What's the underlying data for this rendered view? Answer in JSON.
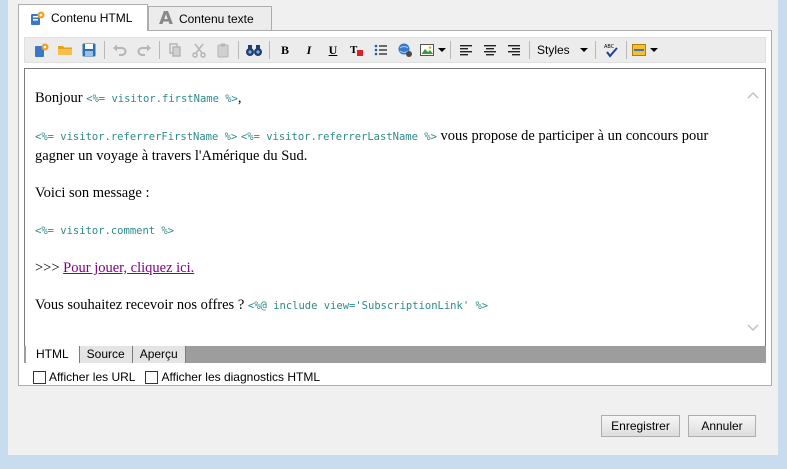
{
  "tabs": [
    {
      "label": "Contenu HTML",
      "icon": "html-doc-icon",
      "active": true
    },
    {
      "label": "Contenu texte",
      "icon": "text-A-icon",
      "active": false
    }
  ],
  "toolbar": {
    "bold": "B",
    "italic": "I",
    "underline": "U",
    "styles_label": "Styles"
  },
  "editor": {
    "greeting_text": "Bonjour ",
    "greeting_code": "<%= visitor.firstName %>",
    "greeting_tail": ",",
    "referrer_first_code": "<%= visitor.referrerFirstName %>",
    "referrer_last_code": "<%= visitor.referrerLastName %>",
    "invite_text": " vous propose de participer à un concours pour gagner un voyage à travers l'Amérique du Sud.",
    "message_label": "Voici son message :",
    "comment_code": "<%= visitor.comment %>",
    "arrows": ">>> ",
    "play_link": "Pour jouer, cliquez ici.",
    "offers_text": "Vous souhaitez recevoir nos offres ? ",
    "include_code": "<%@ include view='SubscriptionLink' %>"
  },
  "view_tabs": [
    {
      "label": "HTML",
      "active": true
    },
    {
      "label": "Source",
      "active": false
    },
    {
      "label": "Aperçu",
      "active": false
    }
  ],
  "checkboxes": [
    {
      "label": "Afficher les URL",
      "checked": false
    },
    {
      "label": "Afficher les diagnostics HTML",
      "checked": false
    }
  ],
  "buttons": {
    "save": "Enregistrer",
    "cancel": "Annuler"
  },
  "colors": {
    "frame": "#c7dcef",
    "code": "#2e8b8b",
    "link": "#800080"
  }
}
